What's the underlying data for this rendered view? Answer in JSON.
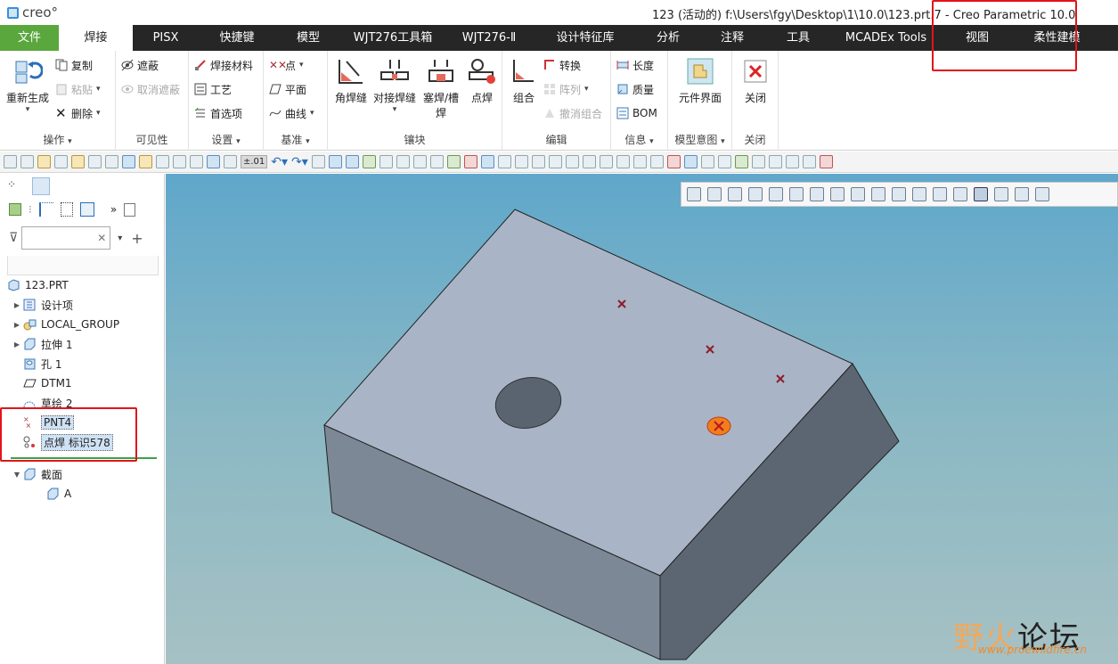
{
  "app": {
    "logo_text": "creo°",
    "title": "123 (活动的) f:\\Users\\fgy\\Desktop\\1\\10.0\\123.prt.7 - Creo Parametric 10.0"
  },
  "menu": {
    "tabs": [
      "文件",
      "焊接",
      "PISX",
      "快捷键",
      "模型",
      "WJT276工具箱",
      "WJT276-Ⅱ",
      "设计特征库",
      "分析",
      "注释",
      "工具",
      "MCADEx Tools",
      "视图",
      "柔性建模"
    ],
    "active": "焊接"
  },
  "ribbon": {
    "groups": {
      "operations": {
        "title": "操作",
        "regenerate": "重新生成",
        "copy": "复制",
        "paste": "粘贴",
        "delete": "删除"
      },
      "visibility": {
        "title": "可见性",
        "hide": "遮蔽",
        "unhide": "取消遮蔽"
      },
      "settings": {
        "title": "设置",
        "material": "焊接材料",
        "process": "工艺",
        "prefs": "首选项"
      },
      "datum": {
        "title": "基准",
        "point": "点",
        "plane": "平面",
        "curve": "曲线"
      },
      "inlay": {
        "title": "镶块",
        "fillet": "角焊缝",
        "butt": "对接焊缝",
        "plug_a": "塞焊/槽",
        "plug_b": "焊",
        "spot": "点焊"
      },
      "edit": {
        "title": "编辑",
        "group": "组合",
        "convert": "转换",
        "pattern": "阵列",
        "ungroup": "撤消组合"
      },
      "info": {
        "title": "信息",
        "length": "长度",
        "mass": "质量",
        "bom": "BOM"
      },
      "model_intent": {
        "title": "模型意图",
        "component_interface": "元件界面"
      },
      "close": {
        "title": "关闭",
        "close": "关闭"
      }
    }
  },
  "qat": {
    "precision": "±.01"
  },
  "tree": {
    "search_placeholder": "",
    "items": [
      {
        "label": "123.PRT"
      },
      {
        "label": "设计项"
      },
      {
        "label": "LOCAL_GROUP"
      },
      {
        "label": "拉伸 1"
      },
      {
        "label": "孔 1"
      },
      {
        "label": "DTM1"
      },
      {
        "label": "草绘 2"
      },
      {
        "label": "PNT4"
      },
      {
        "label": "点焊 标识578"
      },
      {
        "label": "截面"
      },
      {
        "label": "A"
      }
    ]
  },
  "watermark": {
    "part1": "野火",
    "part2": "论坛",
    "url": "www.proewildfire.cn"
  },
  "colors": {
    "menubar": "#262626",
    "file_tab": "#5aa73d",
    "highlight": "#e0151b",
    "part_top": "#a9b5c6",
    "part_left": "#7d8897",
    "part_right": "#5c6673"
  }
}
